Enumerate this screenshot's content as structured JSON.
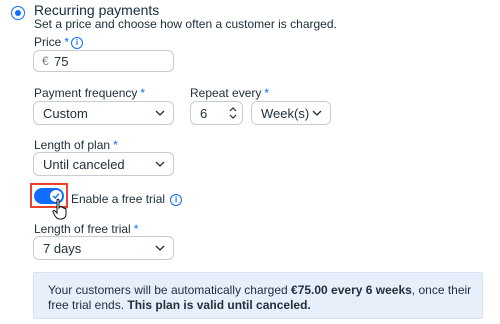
{
  "header": {
    "title": "Recurring payments",
    "subtitle": "Set a price and choose how often a customer is charged."
  },
  "price": {
    "label": "Price",
    "required": "*",
    "currency": "€",
    "value": "75"
  },
  "payment_frequency": {
    "label": "Payment frequency",
    "required": "*",
    "value": "Custom"
  },
  "repeat_every": {
    "label": "Repeat every",
    "required": "*",
    "value": "6",
    "unit": "Week(s)"
  },
  "length_of_plan": {
    "label": "Length of plan",
    "required": "*",
    "value": "Until canceled"
  },
  "free_trial": {
    "label": "Enable a free trial",
    "enabled": true
  },
  "length_of_free_trial": {
    "label": "Length of free trial",
    "required": "*",
    "value": "7 days"
  },
  "summary": {
    "part1": "Your customers will be automatically charged ",
    "amount": "€75.00 every 6 weeks",
    "part2": ", once their free trial ends. ",
    "bold_end": "This plan is valid until canceled."
  },
  "colors": {
    "accent": "#116dff",
    "highlight_border": "#e8432b",
    "info_bg": "#e7f0fa"
  },
  "icons": [
    "radio-selected",
    "info-icon",
    "chevron-down-icon",
    "stepper-arrows-icon",
    "checkmark-icon",
    "hand-cursor-icon"
  ]
}
